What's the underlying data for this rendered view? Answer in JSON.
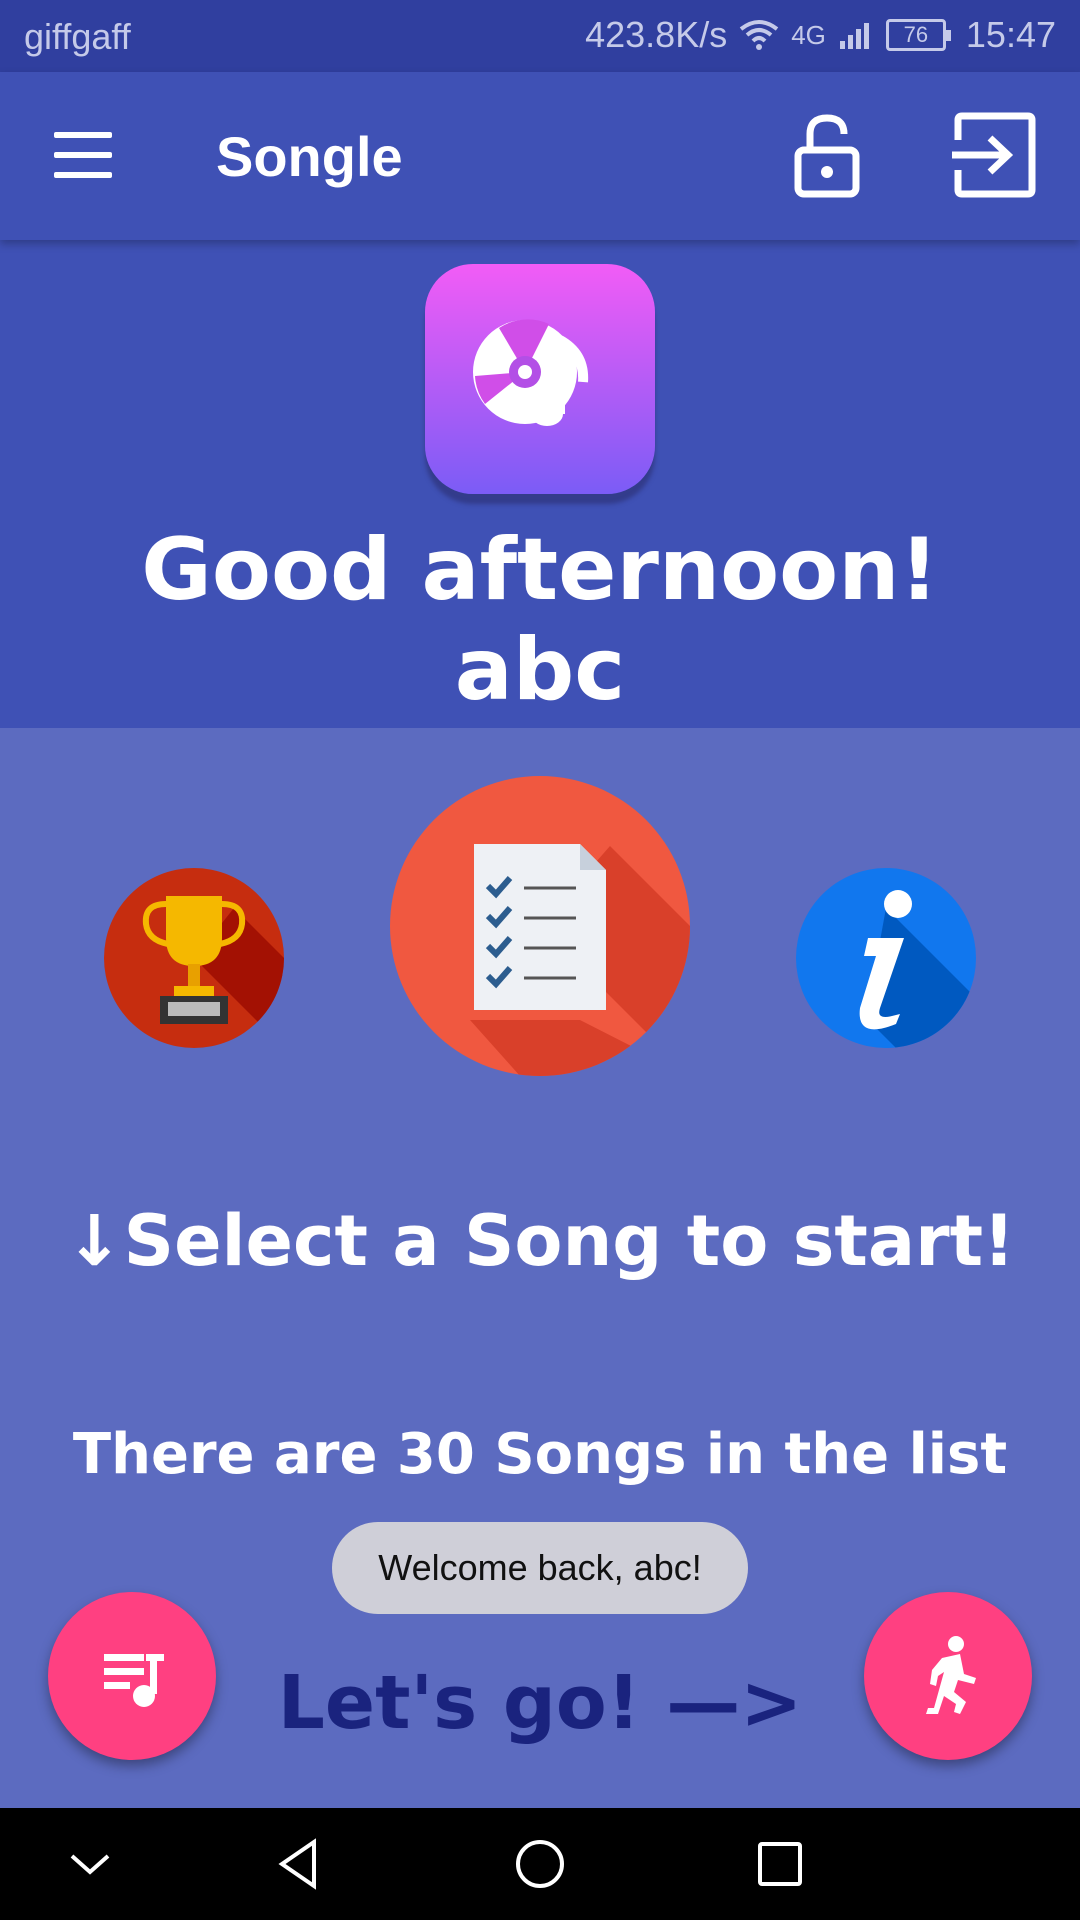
{
  "status_bar": {
    "carrier": "giffgaff",
    "speed": "423.8K/s",
    "network": "4G",
    "battery": "76",
    "time": "15:47"
  },
  "app_bar": {
    "title": "Songle",
    "menu_icon": "hamburger-menu-icon",
    "unlock_icon": "lock-open-icon",
    "logout_icon": "exit-icon"
  },
  "hero": {
    "logo_icon": "music-disc-icon",
    "greeting": "Good afternoon!",
    "username": "abc"
  },
  "actions": {
    "left_icon": "trophy-icon",
    "center_icon": "checklist-document-icon",
    "right_icon": "info-icon"
  },
  "main": {
    "select_prompt": "↓Select a Song to start!",
    "song_count_text": "There are 30 Songs in the list",
    "toast": "Welcome back, abc!",
    "lets_go": "Let's go! —>"
  },
  "fabs": {
    "left_icon": "playlist-music-icon",
    "right_icon": "running-person-icon"
  },
  "colors": {
    "primary_dark": "#303f9f",
    "primary": "#3f51b5",
    "background": "#5c6bc0",
    "accent": "#ff4081"
  }
}
